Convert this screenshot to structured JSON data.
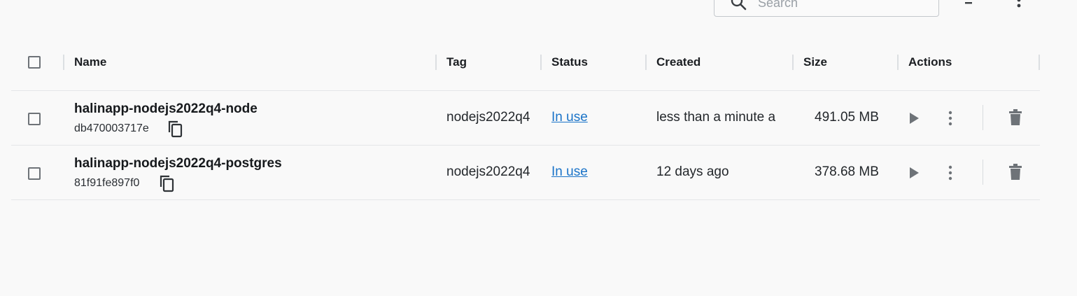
{
  "toolbar": {
    "search_placeholder": "Search"
  },
  "table": {
    "columns": [
      "Name",
      "Tag",
      "Status",
      "Created",
      "Size",
      "Actions"
    ],
    "rows": [
      {
        "name": "halinapp-nodejs2022q4-node",
        "id": "db470003717e",
        "tag": "nodejs2022q4",
        "status": "In use",
        "created": "less than a minute a",
        "size": "491.05 MB"
      },
      {
        "name": "halinapp-nodejs2022q4-postgres",
        "id": "81f91fe897f0",
        "tag": "nodejs2022q4",
        "status": "In use",
        "created": "12 days ago",
        "size": "378.68 MB"
      }
    ]
  },
  "colors": {
    "link": "#1a73c8",
    "icon": "#6e7378",
    "background": "#f9f9f9"
  },
  "icons": [
    "search-icon",
    "filter-icon",
    "more-vert-icon",
    "copy-icon",
    "play-icon",
    "trash-icon"
  ]
}
